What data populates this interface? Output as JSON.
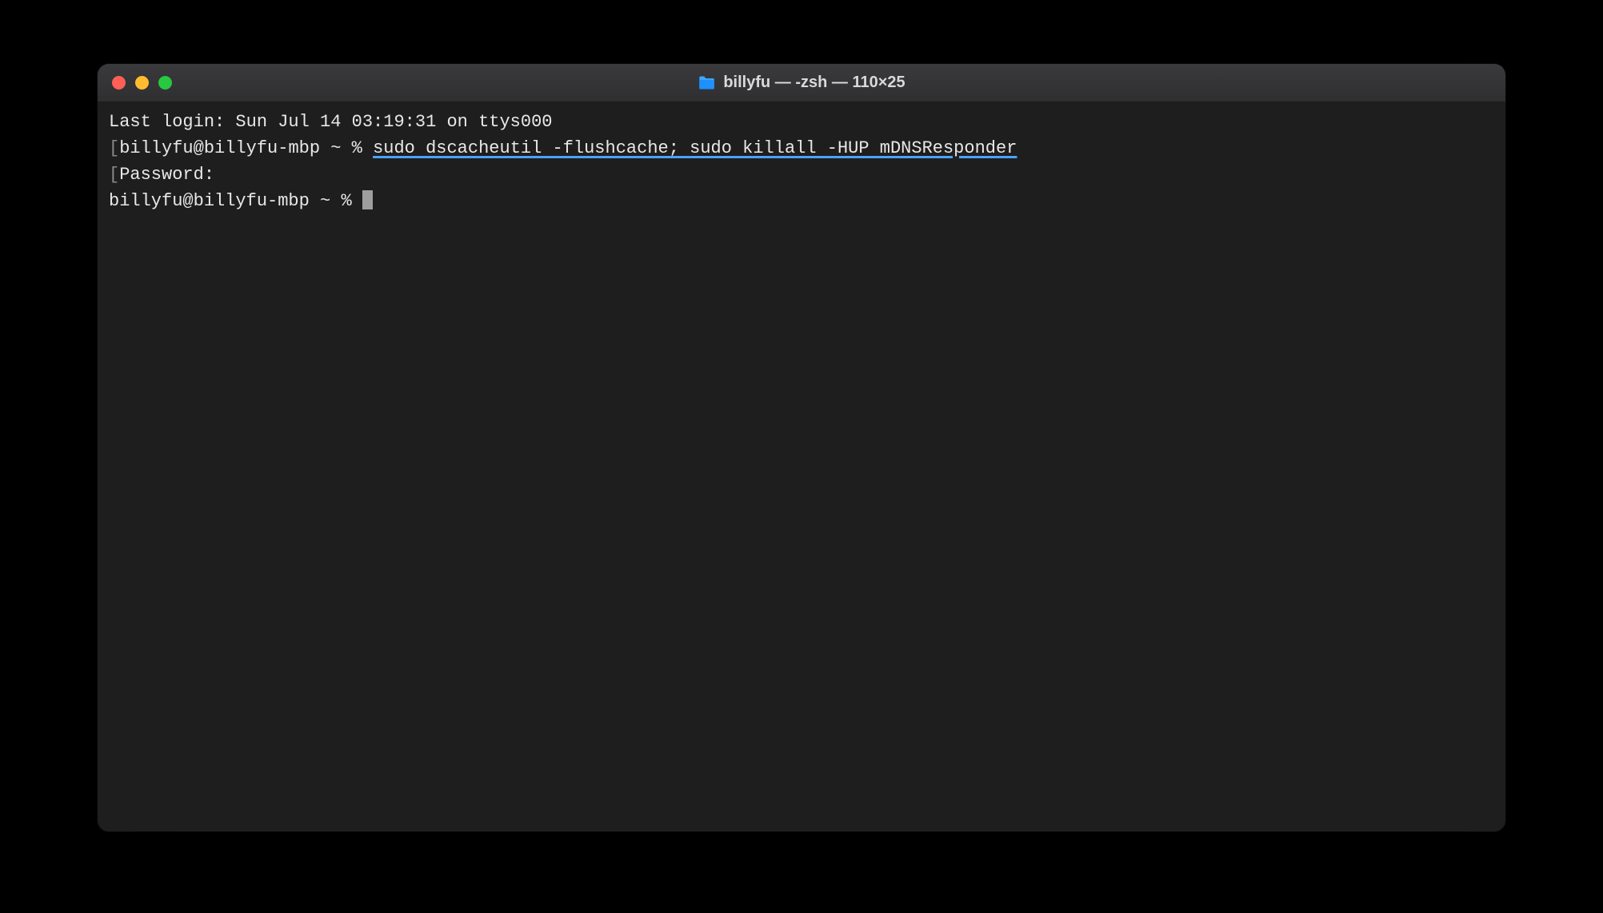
{
  "window": {
    "title": "billyfu — -zsh — 110×25"
  },
  "terminal": {
    "line1": "Last login: Sun Jul 14 03:19:31 on ttys000",
    "line2_bracket_open": "[",
    "line2_prompt": "billyfu@billyfu-mbp ~ % ",
    "line2_command": "sudo dscacheutil -flushcache; sudo killall -HUP mDNSResponder",
    "line3_bracket_open": "[",
    "line3_text": "Password:",
    "line4_prompt": "billyfu@billyfu-mbp ~ % "
  }
}
